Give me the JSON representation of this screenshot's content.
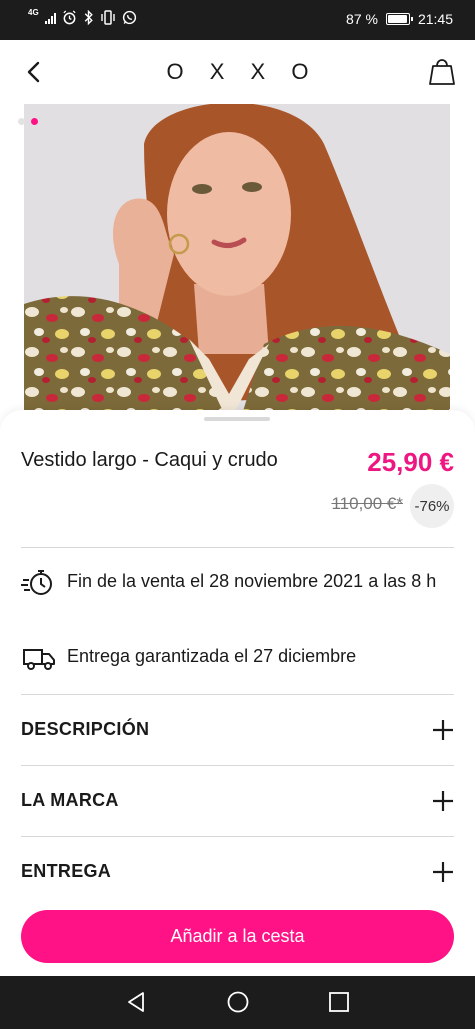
{
  "status_bar": {
    "network": "4G",
    "battery": "87 %",
    "time": "21:45",
    "battery_level": 0.87
  },
  "header": {
    "logo": "OXXO"
  },
  "gallery": {
    "images_count": 2,
    "active_index": 1
  },
  "product": {
    "title": "Vestido largo - Caqui y crudo",
    "price": "25,90 €",
    "old_price": "110,00 €*",
    "discount": "-76%"
  },
  "info": {
    "sale_end": "Fin de la venta el 28 noviembre 2021 a las 8 h",
    "delivery": "Entrega garantizada el 27 diciembre"
  },
  "accordion": [
    {
      "label": "DESCRIPCIÓN"
    },
    {
      "label": "LA MARCA"
    },
    {
      "label": "ENTREGA"
    }
  ],
  "cta": {
    "add_to_cart": "Añadir a la cesta"
  },
  "colors": {
    "accent": "#ff1285",
    "price": "#ee1781",
    "bars": "#1c1c1c"
  },
  "icons": [
    "back-arrow-icon",
    "shopping-bag-icon",
    "stopwatch-icon",
    "delivery-truck-icon",
    "plus-icon",
    "nav-back-icon",
    "nav-home-icon",
    "nav-recents-icon"
  ]
}
